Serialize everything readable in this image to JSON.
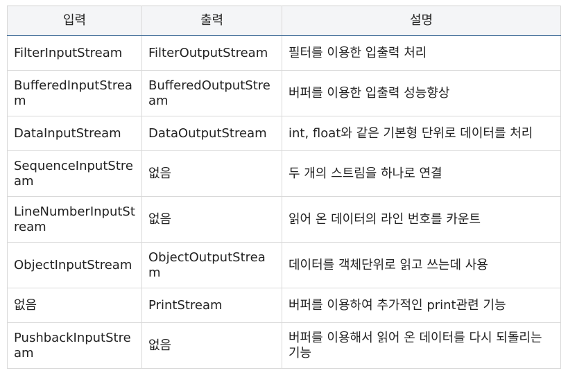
{
  "table": {
    "headers": [
      "입력",
      "출력",
      "설명"
    ],
    "rows": [
      [
        "FilterInputStream",
        "FilterOutputStream",
        "필터를 이용한 입출력 처리"
      ],
      [
        "BufferedInputStream",
        "BufferedOutputStream",
        "버퍼를 이용한 입출력 성능향상"
      ],
      [
        "DataInputStream",
        "DataOutputStream",
        "int, float와 같은 기본형 단위로 데이터를 처리"
      ],
      [
        "SequenceInputStream",
        "없음",
        "두 개의 스트림을 하나로 연결"
      ],
      [
        "LineNumberInputStream",
        "없음",
        "읽어 온 데이터의 라인 번호를 카운트"
      ],
      [
        "ObjectInputStream",
        "ObjectOutputStream",
        "데이터를 객체단위로 읽고 쓰는데 사용"
      ],
      [
        "없음",
        "PrintStream",
        "버퍼를 이용하여 추가적인 print관련 기능"
      ],
      [
        "PushbackInputStream",
        "없음",
        "버퍼를 이용해서 읽어 온 데이터를 다시 되돌리는 기능"
      ]
    ]
  }
}
